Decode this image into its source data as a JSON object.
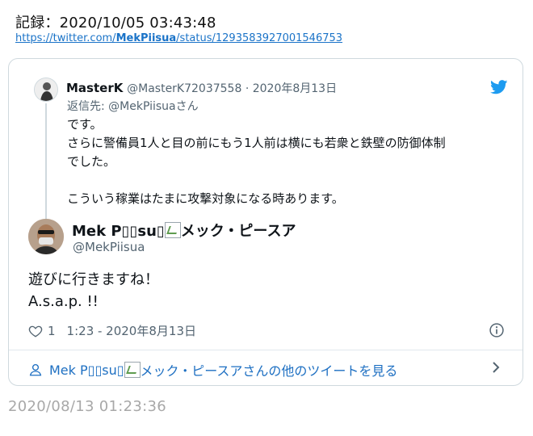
{
  "record_label": "記録：2020/10/05 03:43:48",
  "source_url": {
    "prefix": "https://twitter.com/",
    "handle": "MekPiisua",
    "suffix": "/status/1293583927001546753"
  },
  "quoted_tweet": {
    "display_name": "MasterK",
    "handle_date": "@MasterK72037558 · 2020年8月13日",
    "reply_to": "返信先: @MekPiisuaさん",
    "lines": [
      "です。",
      "さらに警備員1人と目の前にもう1人前は横にも若衆と鉄壁の防御体制",
      "でした。",
      "",
      "こういう稼業はたまに攻撃対象になる時あります。"
    ]
  },
  "main_tweet": {
    "name_prefix": "Mek P▯▯su▯",
    "name_suffix": "メック・ピースア",
    "handle": "@MekPiisua",
    "text_lines": [
      "遊びに行きますね！",
      "A.s.a.p. !!"
    ],
    "like_count": "1",
    "timestamp": "1:23 - 2020年8月13日"
  },
  "more_link": {
    "prefix": "Mek P▯▯su▯",
    "suffix": "メック・ピースアさんの他のツイートを見る"
  },
  "footer_timestamp": "2020/08/13 01:23:36",
  "icons": [
    "twitter-bird-icon",
    "heart-icon",
    "info-icon",
    "person-icon",
    "chevron-right-icon",
    "broken-image-icon"
  ],
  "colors": {
    "link": "#1a73c8",
    "twitter_blue": "#1d9bf0",
    "secondary_text": "#536471"
  }
}
